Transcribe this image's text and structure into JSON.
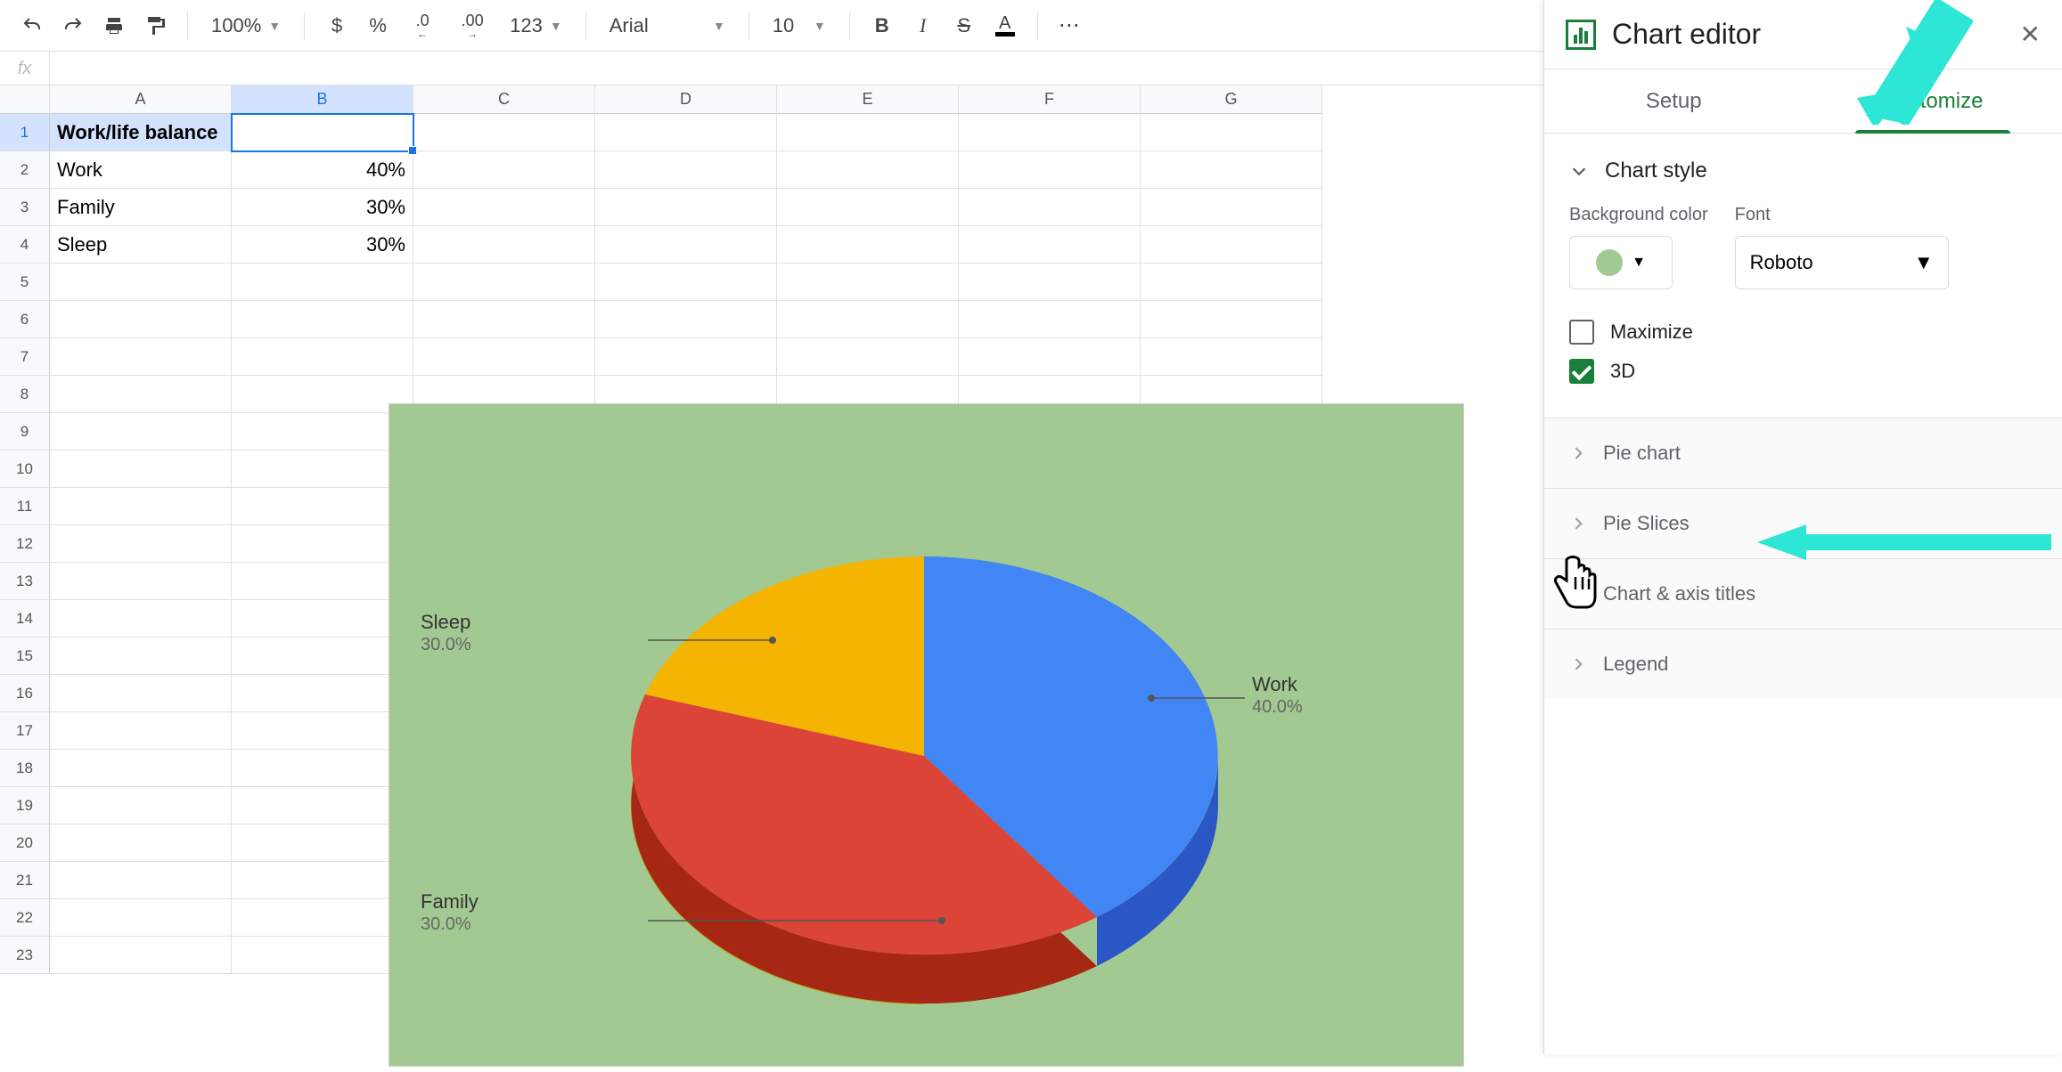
{
  "toolbar": {
    "zoom": "100%",
    "currency": "$",
    "percent": "%",
    "decDec": ".0",
    "incDec": ".00",
    "formats": "123",
    "font": "Arial",
    "fontSize": "10",
    "bold": "B",
    "italic": "I",
    "strike": "S",
    "textColor": "A",
    "more": "⋯"
  },
  "formula": {
    "fx": "fx"
  },
  "columns": [
    "A",
    "B",
    "C",
    "D",
    "E",
    "F",
    "G"
  ],
  "rows": [
    "1",
    "2",
    "3",
    "4",
    "5",
    "6",
    "7",
    "8",
    "9",
    "10",
    "11",
    "12",
    "13",
    "14",
    "15",
    "16",
    "17",
    "18",
    "19",
    "20",
    "21",
    "22",
    "23"
  ],
  "sheet": {
    "a1": "Work/life balance",
    "a2": "Work",
    "b2": "40%",
    "a3": "Family",
    "b3": "30%",
    "a4": "Sleep",
    "b4": "30%"
  },
  "chart_data": {
    "type": "pie",
    "title": "",
    "series": [
      {
        "name": "Work",
        "value": 40,
        "label": "40.0%",
        "color": "#4285f4"
      },
      {
        "name": "Family",
        "value": 30,
        "label": "30.0%",
        "color": "#db4437"
      },
      {
        "name": "Sleep",
        "value": 30,
        "label": "30.0%",
        "color": "#f4b400"
      }
    ],
    "background": "#a3c993",
    "is_3d": true,
    "labels": {
      "work_name": "Work",
      "work_pct": "40.0%",
      "family_name": "Family",
      "family_pct": "30.0%",
      "sleep_name": "Sleep",
      "sleep_pct": "30.0%"
    }
  },
  "panel": {
    "title": "Chart editor",
    "tabs": {
      "setup": "Setup",
      "customize": "Customize"
    },
    "chartStyle": "Chart style",
    "bgLabel": "Background color",
    "fontLabel": "Font",
    "fontValue": "Roboto",
    "maximize": "Maximize",
    "threeD": "3D",
    "sections": {
      "pieChart": "Pie chart",
      "pieSlices": "Pie Slices",
      "axisTitles": "Chart & axis titles",
      "legend": "Legend"
    }
  }
}
